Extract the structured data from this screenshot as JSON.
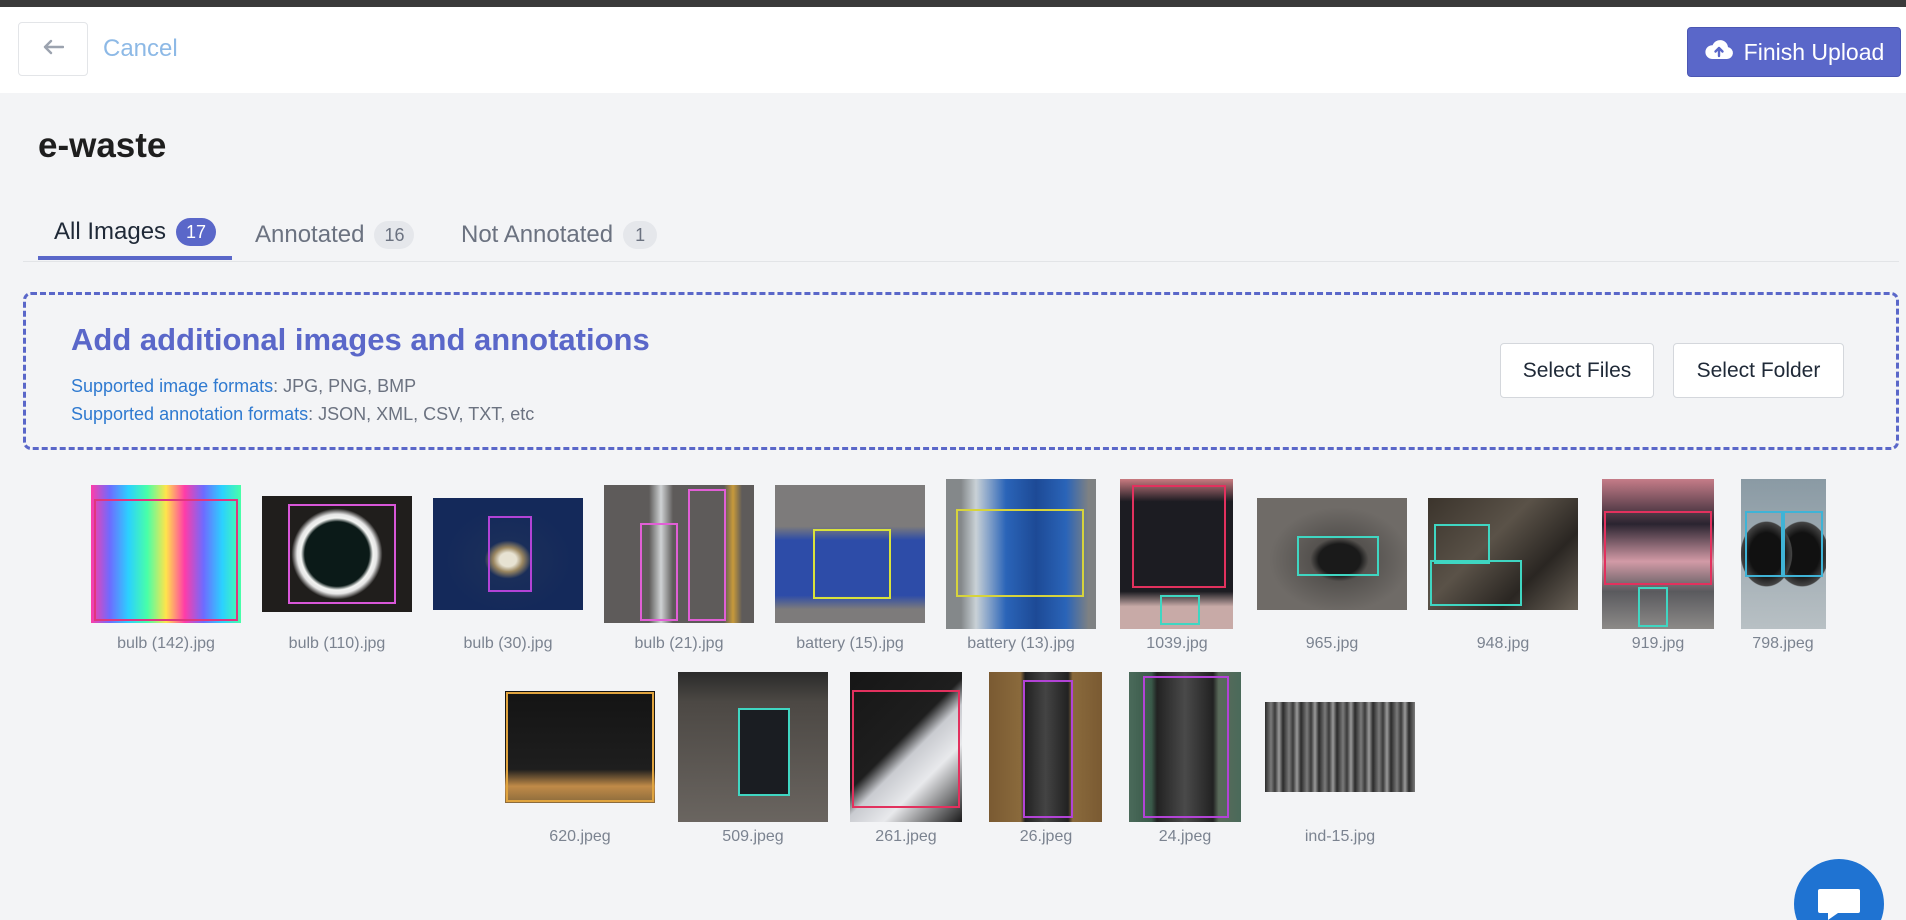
{
  "header": {
    "back_icon": "arrow-left-icon",
    "cancel_label": "Cancel",
    "finish_label": "Finish Upload",
    "finish_icon": "cloud-upload-icon"
  },
  "page": {
    "title": "e-waste"
  },
  "tabs": [
    {
      "label": "All Images",
      "count": "17",
      "active": true
    },
    {
      "label": "Annotated",
      "count": "16",
      "active": false
    },
    {
      "label": "Not Annotated",
      "count": "1",
      "active": false
    }
  ],
  "dropzone": {
    "title": "Add additional images and annotations",
    "image_formats_key": "Supported image formats",
    "image_formats_value": ": JPG, PNG, BMP",
    "annotation_formats_key": "Supported annotation formats",
    "annotation_formats_value": ": JSON, XML, CSV, TXT, etc",
    "select_files_label": "Select Files",
    "select_folder_label": "Select Folder"
  },
  "images": [
    {
      "name": "bulb (142).jpg"
    },
    {
      "name": "bulb (110).jpg"
    },
    {
      "name": "bulb (30).jpg"
    },
    {
      "name": "bulb (21).jpg"
    },
    {
      "name": "battery (15).jpg"
    },
    {
      "name": "battery (13).jpg"
    },
    {
      "name": "1039.jpg"
    },
    {
      "name": "965.jpg"
    },
    {
      "name": "948.jpg"
    },
    {
      "name": "919.jpg"
    },
    {
      "name": "798.jpeg"
    },
    {
      "name": "620.jpeg"
    },
    {
      "name": "509.jpeg"
    },
    {
      "name": "261.jpeg"
    },
    {
      "name": "26.jpeg"
    },
    {
      "name": "24.jpeg"
    },
    {
      "name": "ind-15.jpg"
    }
  ],
  "colors": {
    "accent": "#5a67c9",
    "link": "#2f7ad0",
    "cancel": "#8db9e6",
    "chat": "#1f73d2"
  },
  "chat_icon": "chat-icon"
}
